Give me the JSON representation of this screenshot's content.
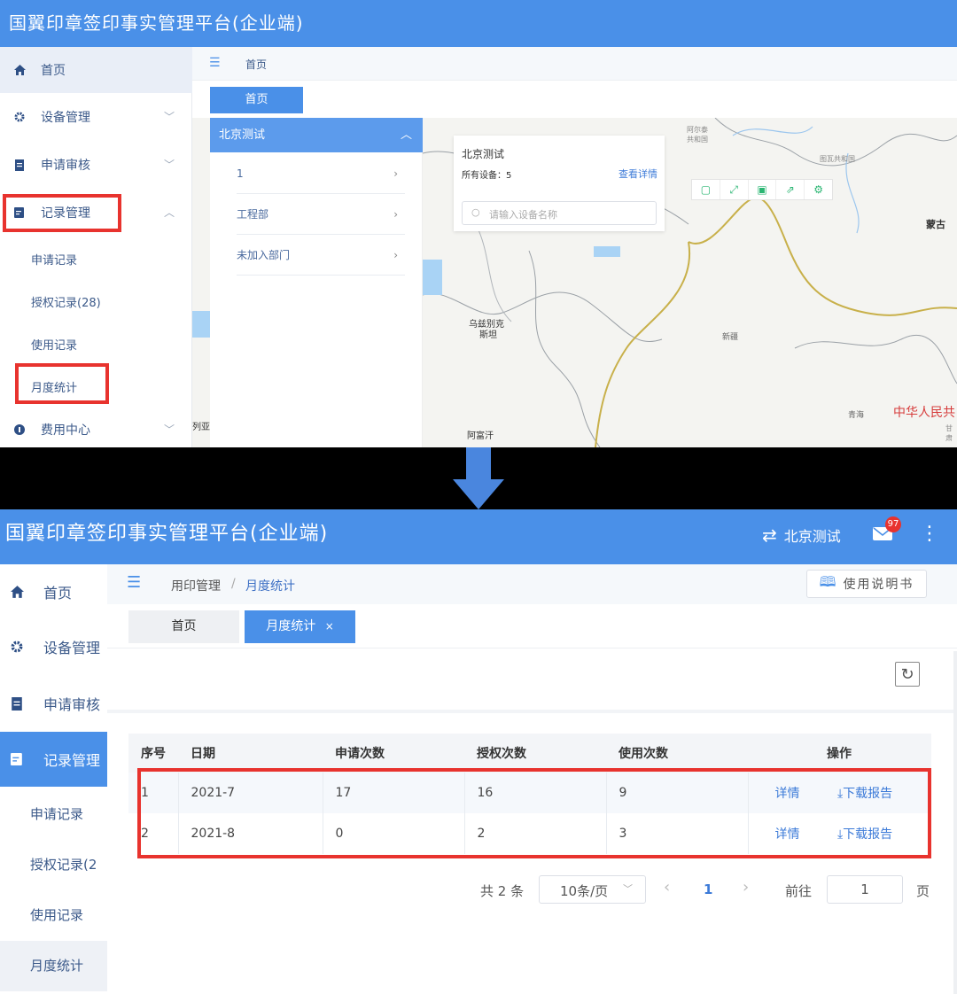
{
  "top": {
    "title": "国翼印章签印事实管理平台(企业端)",
    "breadcrumb": "首页",
    "tab": "首页",
    "sidebar": {
      "home": "首页",
      "device": "设备管理",
      "apply": "申请审核",
      "records": "记录管理",
      "sub": [
        "申请记录",
        "授权记录(28)",
        "使用记录",
        "月度统计"
      ],
      "fee": "费用中心"
    },
    "dept": {
      "header": "北京测试",
      "rows": [
        "1",
        "工程部",
        "未加入部门"
      ]
    },
    "map": {
      "popup_title": "北京测试",
      "popup_devices": "所有设备：5",
      "popup_link": "查看详情",
      "search_placeholder": "请输入设备名称",
      "labels": {
        "mongolia": "蒙古",
        "uzbek1": "乌兹别克",
        "uzbek2": "斯坦",
        "xinjiang": "新疆",
        "qinghai": "青海",
        "china": "中华人民共",
        "afghan": "阿富汗",
        "left": "列亚",
        "russia1": "阿尔泰",
        "russia2": "共和国",
        "tuva": "图瓦共和国",
        "gansu": "甘肃"
      }
    }
  },
  "bottom": {
    "title": "国翼印章签印事实管理平台(企业端)",
    "org": "北京测试",
    "mail_badge": "97",
    "sidebar": {
      "home": "首页",
      "device": "设备管理",
      "apply": "申请审核",
      "records": "记录管理",
      "sub": [
        "申请记录",
        "授权记录(2",
        "使用记录",
        "月度统计"
      ]
    },
    "breadcrumb": {
      "parent": "用印管理",
      "sep": "/",
      "current": "月度统计"
    },
    "manual_button": "使用说明书",
    "tabs": {
      "home": "首页",
      "current": "月度统计",
      "close": "×"
    },
    "table": {
      "headers": [
        "序号",
        "日期",
        "申请次数",
        "授权次数",
        "使用次数",
        "操作"
      ],
      "rows": [
        {
          "no": "1",
          "date": "2021-7",
          "apply": "17",
          "auth": "16",
          "use": "9",
          "detail": "详情",
          "download": "下载报告"
        },
        {
          "no": "2",
          "date": "2021-8",
          "apply": "0",
          "auth": "2",
          "use": "3",
          "detail": "详情",
          "download": "下载报告"
        }
      ]
    },
    "pager": {
      "total": "共 2 条",
      "size": "10条/页",
      "prev": "‹",
      "page": "1",
      "next": "›",
      "goto": "前往",
      "goto_value": "1",
      "unit": "页"
    }
  },
  "colors": {
    "primary": "#4a90e8",
    "highlight": "#e8332e",
    "link": "#3d7bd8"
  }
}
